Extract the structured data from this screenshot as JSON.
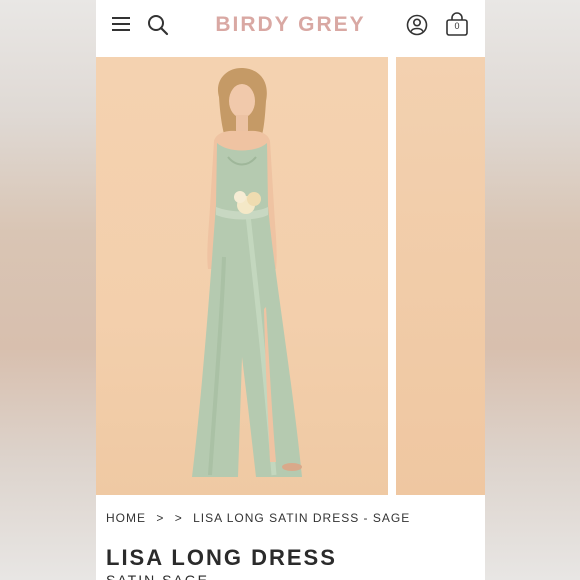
{
  "header": {
    "brand": "BIRDY GREY",
    "cart_count": "0"
  },
  "icons": {
    "menu": "hamburger-menu-icon",
    "search": "search-icon",
    "account": "user-account-icon",
    "cart": "shopping-bag-icon"
  },
  "colors": {
    "brand": "#d9a8a3",
    "background": "#f3cfac",
    "dress": "#b9cdb4"
  },
  "breadcrumb": {
    "home": "HOME",
    "separator": ">",
    "current": "LISA LONG SATIN DRESS - SAGE"
  },
  "product": {
    "title": "LISA LONG DRESS",
    "subtitle": "SATIN SAGE"
  }
}
